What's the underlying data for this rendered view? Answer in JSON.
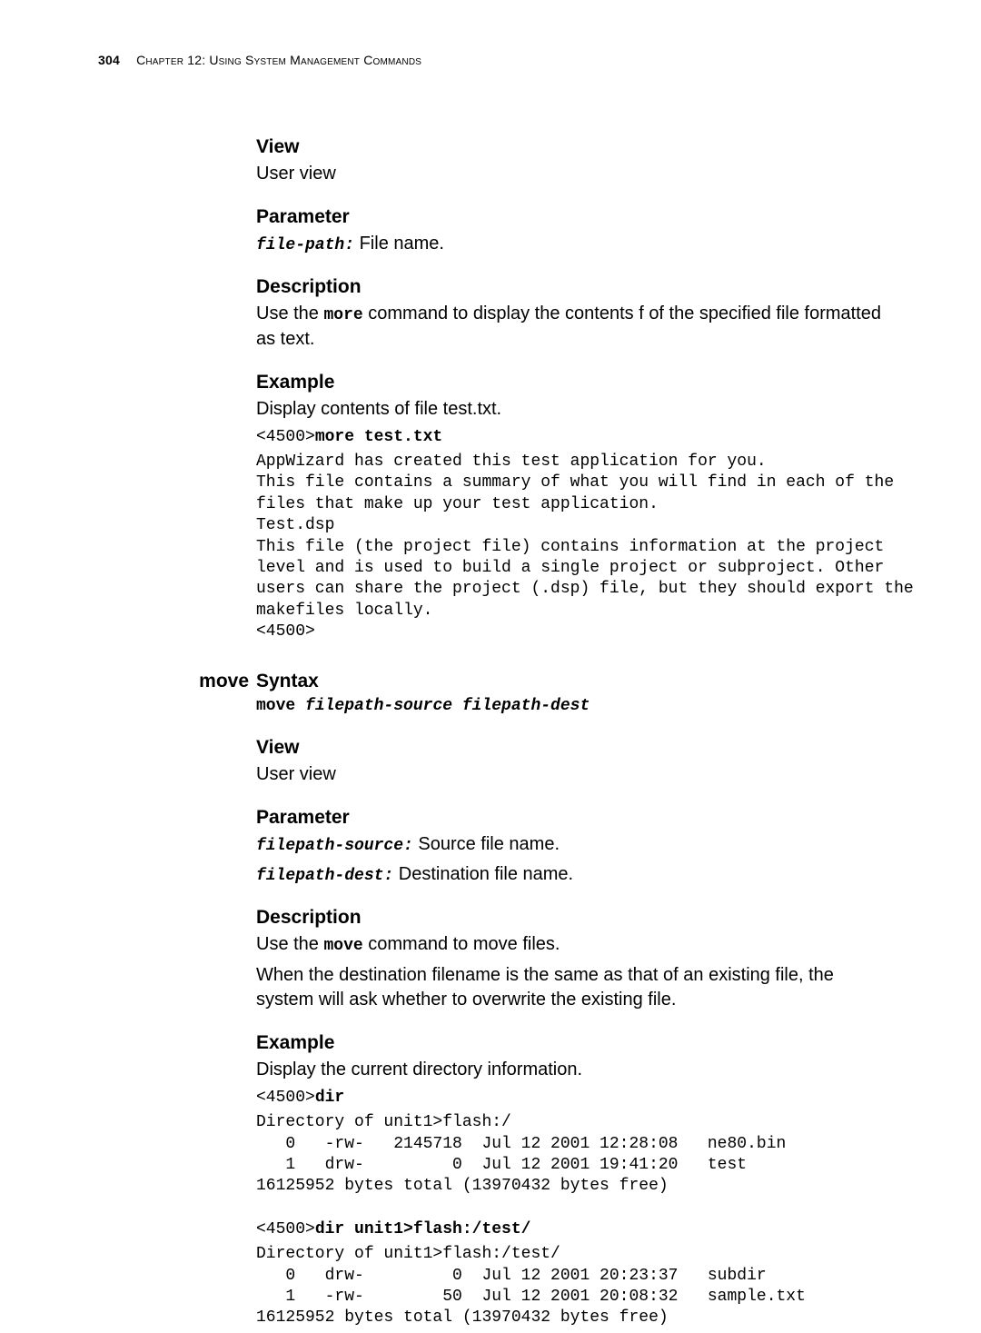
{
  "header": {
    "page_number": "304",
    "chapter": "Chapter 12: Using System Management Commands"
  },
  "more": {
    "view_head": "View",
    "view_text": "User view",
    "param_head": "Parameter",
    "param_name": "file-path:",
    "param_desc": " File name.",
    "desc_head": "Description",
    "desc_pre": "Use the ",
    "desc_cmd": "more",
    "desc_post": " command to display the contents f of the specified file formatted as text.",
    "ex_head": "Example",
    "ex_intro": "Display contents of file test.txt.",
    "ex_prompt": "<4500>",
    "ex_cmd": "more test.txt",
    "ex_output": "AppWizard has created this test application for you.\nThis file contains a summary of what you will find in each of the\nfiles that make up your test application.\nTest.dsp\nThis file (the project file) contains information at the project\nlevel and is used to build a single project or subproject. Other\nusers can share the project (.dsp) file, but they should export the\nmakefiles locally.\n<4500>"
  },
  "move": {
    "side": "move",
    "syntax_head": "Syntax",
    "syntax_line_cmd": "move ",
    "syntax_line_args": "filepath-source filepath-dest",
    "view_head": "View",
    "view_text": "User view",
    "param_head": "Parameter",
    "p1_name": "filepath-source:",
    "p1_desc": " Source file name.",
    "p2_name": "filepath-dest:",
    "p2_desc": " Destination file name.",
    "desc_head": "Description",
    "desc_pre": "Use the ",
    "desc_cmd": "move",
    "desc_post": " command to move files.",
    "desc_p2": "When the destination filename is the same as that of an existing file, the system will ask whether to overwrite the existing file.",
    "ex_head": "Example",
    "ex_intro": "Display the current directory information.",
    "ex1_prompt": "<4500>",
    "ex1_cmd": "dir",
    "ex1_output": "Directory of unit1>flash:/\n   0   -rw-   2145718  Jul 12 2001 12:28:08   ne80.bin\n   1   drw-         0  Jul 12 2001 19:41:20   test\n16125952 bytes total (13970432 bytes free)",
    "ex2_prompt": "<4500>",
    "ex2_cmd": "dir unit1>flash:/test/",
    "ex2_output": "Directory of unit1>flash:/test/\n   0   drw-         0  Jul 12 2001 20:23:37   subdir\n   1   -rw-        50  Jul 12 2001 20:08:32   sample.txt\n16125952 bytes total (13970432 bytes free)"
  }
}
